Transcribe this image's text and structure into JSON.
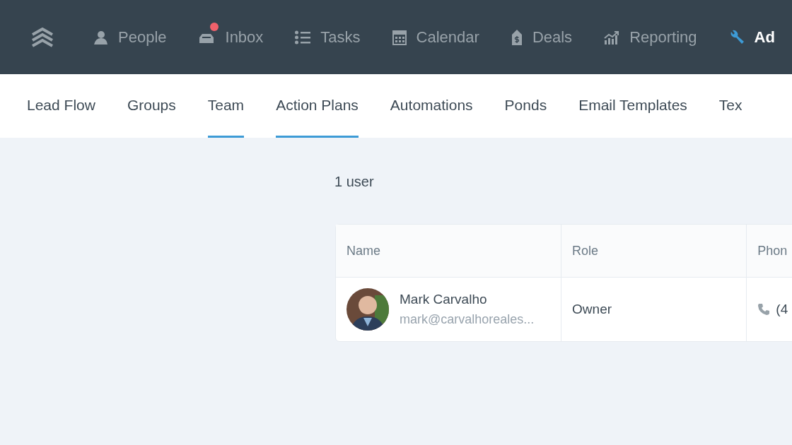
{
  "top_nav": [
    {
      "kind": "logo"
    },
    {
      "kind": "people",
      "label": "People",
      "selected": false,
      "badge": false
    },
    {
      "kind": "inbox",
      "label": "Inbox",
      "selected": false,
      "badge": true
    },
    {
      "kind": "tasks",
      "label": "Tasks",
      "selected": false,
      "badge": false
    },
    {
      "kind": "calendar",
      "label": "Calendar",
      "selected": false,
      "badge": false
    },
    {
      "kind": "deals",
      "label": "Deals",
      "selected": false,
      "badge": false
    },
    {
      "kind": "reporting",
      "label": "Reporting",
      "selected": false,
      "badge": false
    },
    {
      "kind": "admin",
      "label": "Ad",
      "selected": true,
      "badge": false
    }
  ],
  "sub_tabs": [
    {
      "label": "Lead Flow",
      "underlined": false
    },
    {
      "label": "Groups",
      "underlined": false
    },
    {
      "label": "Team",
      "underlined": true
    },
    {
      "label": "Action Plans",
      "underlined": true
    },
    {
      "label": "Automations",
      "underlined": false
    },
    {
      "label": "Ponds",
      "underlined": false
    },
    {
      "label": "Email Templates",
      "underlined": false
    },
    {
      "label": "Tex",
      "underlined": false
    }
  ],
  "user_count": "1 user",
  "table": {
    "columns": [
      "Name",
      "Role",
      "Phon"
    ],
    "rows": [
      {
        "name": "Mark Carvalho",
        "email": "mark@carvalhoreales...",
        "role": "Owner",
        "phone": "(4"
      }
    ]
  }
}
